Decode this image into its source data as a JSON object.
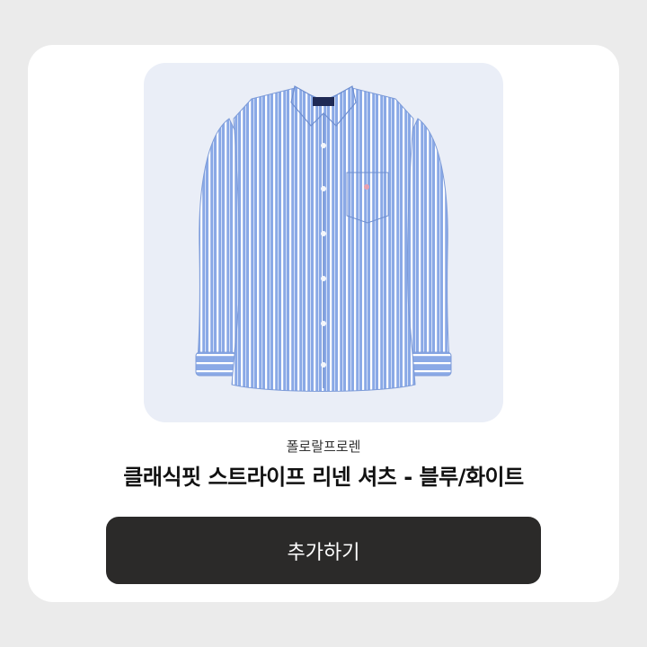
{
  "product": {
    "brand": "폴로랄프로렌",
    "title": "클래식핏 스트라이프 리넨 셔츠 - 블루/화이트",
    "image_icon": "striped-shirt-photo",
    "image_bg": "#eaeef7",
    "shirt_color": "#8aa9e6",
    "stripe_color": "#ffffff"
  },
  "actions": {
    "add_label": "추가하기",
    "button_color": "#2b2a29"
  }
}
